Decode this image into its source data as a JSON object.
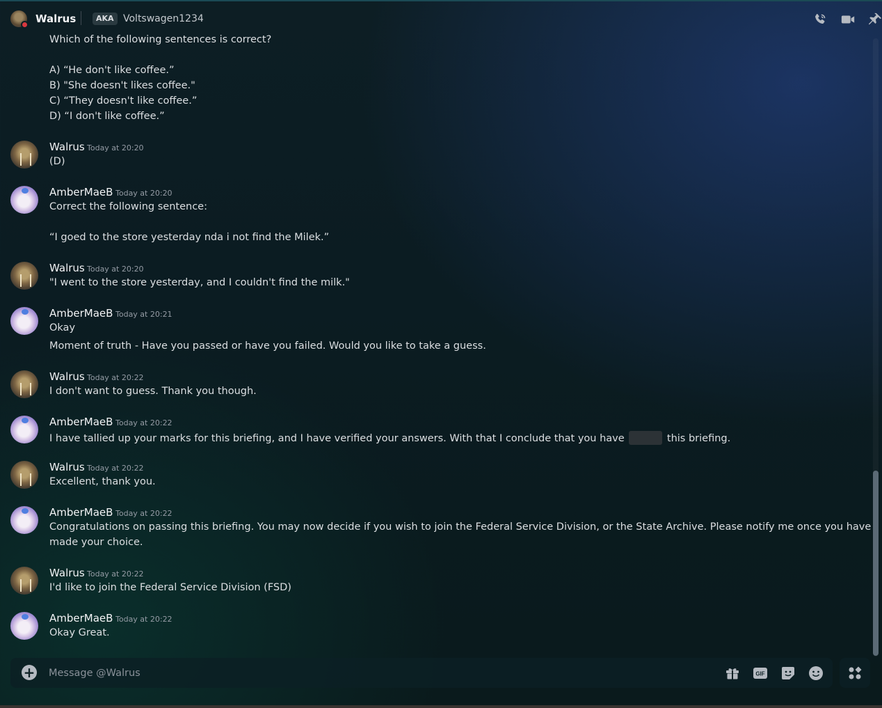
{
  "header": {
    "name": "Walrus",
    "aka_badge": "AKA",
    "alias": "Voltswagen1234"
  },
  "partial_message": {
    "lines": [
      "Which of the following sentences is correct?",
      "A) “He don't like coffee.”",
      "B) \"She doesn't likes coffee.\"",
      "C) “They doesn't like coffee.”",
      "D) “I don't like coffee.”"
    ]
  },
  "messages": [
    {
      "author": "Walrus",
      "time": "Today at 20:20",
      "lines": [
        "(D)"
      ]
    },
    {
      "author": "AmberMaeB",
      "time": "Today at 20:20",
      "lines": [
        "Correct the following sentence:",
        "“I goed to the store yesterday nda i not find the Milek.”"
      ]
    },
    {
      "author": "Walrus",
      "time": "Today at 20:20",
      "lines": [
        "\"I went to the store yesterday, and I couldn't find the milk.\""
      ]
    },
    {
      "author": "AmberMaeB",
      "time": "Today at 20:21",
      "lines": [
        "Okay",
        "Moment of truth - Have you passed or have you failed. Would you like to take a guess."
      ]
    },
    {
      "author": "Walrus",
      "time": "Today at 20:22",
      "lines": [
        "I don't want to guess. Thank you though."
      ]
    },
    {
      "author": "AmberMaeB",
      "time": "Today at 20:22",
      "lines": [
        "I have tallied up your marks for this briefing, and I have verified your answers. With that I conclude that you have",
        "this briefing."
      ]
    },
    {
      "author": "Walrus",
      "time": "Today at 20:22",
      "lines": [
        "Excellent, thank you."
      ]
    },
    {
      "author": "AmberMaeB",
      "time": "Today at 20:22",
      "lines": [
        "Congratulations on passing this briefing. You may now decide if you wish to join the Federal Service Division, or the State Archive. Please notify me once you have",
        "made your choice."
      ]
    },
    {
      "author": "Walrus",
      "time": "Today at 20:22",
      "lines": [
        "I'd like to join the Federal Service Division (FSD)"
      ]
    },
    {
      "author": "AmberMaeB",
      "time": "Today at 20:22",
      "lines": [
        "Okay Great."
      ]
    }
  ],
  "composer": {
    "placeholder": "Message @Walrus",
    "gif_label": "GIF"
  },
  "icons": {
    "header": [
      "phone-call-icon",
      "video-call-icon",
      "pin-icon"
    ],
    "composer": [
      "gift-icon",
      "gif-icon",
      "sticker-icon",
      "emoji-icon",
      "apps-icon"
    ]
  },
  "colors": {
    "status_dnd": "#d8383f",
    "text": "#dbdee1",
    "timestamp": "#949ba4"
  }
}
